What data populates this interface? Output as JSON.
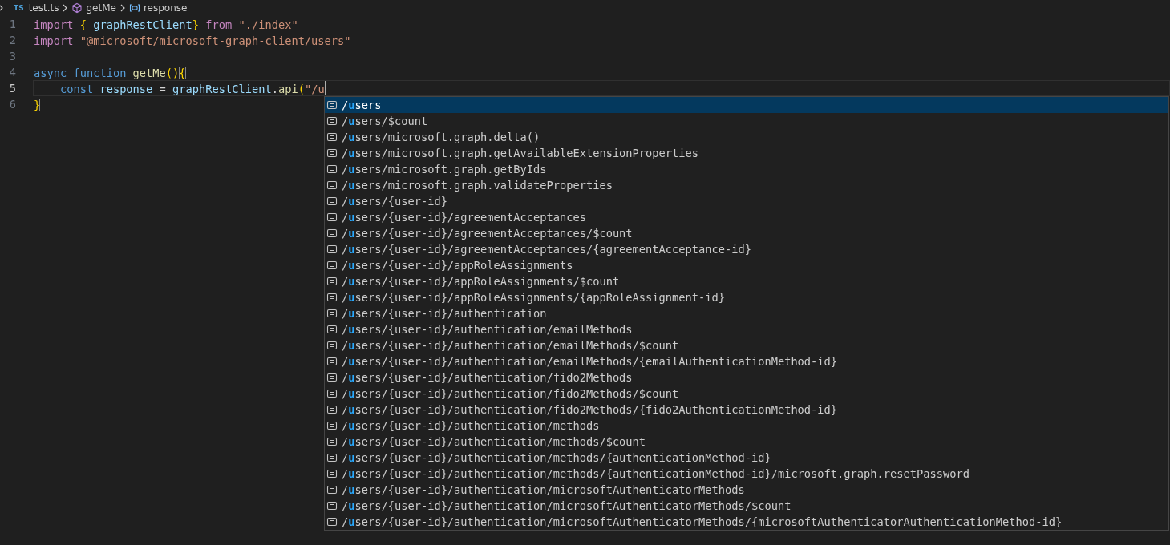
{
  "breadcrumb": {
    "file_badge": "TS",
    "file": "test.ts",
    "function": "getMe",
    "variable": "response"
  },
  "editor": {
    "lines": [
      {
        "number": "1",
        "current": false,
        "tokens": [
          {
            "kind": "control",
            "text": "import"
          },
          {
            "kind": "bracket",
            "text": " {"
          },
          {
            "kind": "variable",
            "text": " graphRestClient"
          },
          {
            "kind": "bracket",
            "text": "}"
          },
          {
            "kind": "control",
            "text": " from"
          },
          {
            "kind": "string",
            "text": " \"./index\""
          }
        ]
      },
      {
        "number": "2",
        "current": false,
        "tokens": [
          {
            "kind": "control",
            "text": "import"
          },
          {
            "kind": "string",
            "text": " \"@microsoft/microsoft-graph-client/users\""
          }
        ]
      },
      {
        "number": "3",
        "current": false
      },
      {
        "number": "4",
        "current": false,
        "tokens": [
          {
            "kind": "keyword",
            "text": "async"
          },
          {
            "kind": "keyword",
            "text": " function"
          },
          {
            "kind": "function",
            "text": " getMe"
          },
          {
            "kind": "bracket",
            "text": "()"
          },
          {
            "kind": "matched",
            "text": "{"
          }
        ]
      },
      {
        "number": "5",
        "current": true,
        "tokens": [
          {
            "kind": "keyword",
            "text": "    const"
          },
          {
            "kind": "variable",
            "text": " response"
          },
          {
            "kind": "plain",
            "text": " = "
          },
          {
            "kind": "variable",
            "text": "graphRestClient"
          },
          {
            "kind": "plain",
            "text": "."
          },
          {
            "kind": "function",
            "text": "api"
          },
          {
            "kind": "bracket",
            "text": "("
          },
          {
            "kind": "string",
            "text": "\"/u"
          }
        ]
      },
      {
        "number": "6",
        "current": false,
        "tokens": [
          {
            "kind": "matched",
            "text": "}"
          }
        ]
      }
    ]
  },
  "suggestions": [
    {
      "lead": "/",
      "match": "u",
      "rest": "sers",
      "selected": true
    },
    {
      "lead": "/",
      "match": "u",
      "rest": "sers/$count",
      "selected": false
    },
    {
      "lead": "/",
      "match": "u",
      "rest": "sers/microsoft.graph.delta()",
      "selected": false
    },
    {
      "lead": "/",
      "match": "u",
      "rest": "sers/microsoft.graph.getAvailableExtensionProperties",
      "selected": false
    },
    {
      "lead": "/",
      "match": "u",
      "rest": "sers/microsoft.graph.getByIds",
      "selected": false
    },
    {
      "lead": "/",
      "match": "u",
      "rest": "sers/microsoft.graph.validateProperties",
      "selected": false
    },
    {
      "lead": "/",
      "match": "u",
      "rest": "sers/{user-id}",
      "selected": false
    },
    {
      "lead": "/",
      "match": "u",
      "rest": "sers/{user-id}/agreementAcceptances",
      "selected": false
    },
    {
      "lead": "/",
      "match": "u",
      "rest": "sers/{user-id}/agreementAcceptances/$count",
      "selected": false
    },
    {
      "lead": "/",
      "match": "u",
      "rest": "sers/{user-id}/agreementAcceptances/{agreementAcceptance-id}",
      "selected": false
    },
    {
      "lead": "/",
      "match": "u",
      "rest": "sers/{user-id}/appRoleAssignments",
      "selected": false
    },
    {
      "lead": "/",
      "match": "u",
      "rest": "sers/{user-id}/appRoleAssignments/$count",
      "selected": false
    },
    {
      "lead": "/",
      "match": "u",
      "rest": "sers/{user-id}/appRoleAssignments/{appRoleAssignment-id}",
      "selected": false
    },
    {
      "lead": "/",
      "match": "u",
      "rest": "sers/{user-id}/authentication",
      "selected": false
    },
    {
      "lead": "/",
      "match": "u",
      "rest": "sers/{user-id}/authentication/emailMethods",
      "selected": false
    },
    {
      "lead": "/",
      "match": "u",
      "rest": "sers/{user-id}/authentication/emailMethods/$count",
      "selected": false
    },
    {
      "lead": "/",
      "match": "u",
      "rest": "sers/{user-id}/authentication/emailMethods/{emailAuthenticationMethod-id}",
      "selected": false
    },
    {
      "lead": "/",
      "match": "u",
      "rest": "sers/{user-id}/authentication/fido2Methods",
      "selected": false
    },
    {
      "lead": "/",
      "match": "u",
      "rest": "sers/{user-id}/authentication/fido2Methods/$count",
      "selected": false
    },
    {
      "lead": "/",
      "match": "u",
      "rest": "sers/{user-id}/authentication/fido2Methods/{fido2AuthenticationMethod-id}",
      "selected": false
    },
    {
      "lead": "/",
      "match": "u",
      "rest": "sers/{user-id}/authentication/methods",
      "selected": false
    },
    {
      "lead": "/",
      "match": "u",
      "rest": "sers/{user-id}/authentication/methods/$count",
      "selected": false
    },
    {
      "lead": "/",
      "match": "u",
      "rest": "sers/{user-id}/authentication/methods/{authenticationMethod-id}",
      "selected": false
    },
    {
      "lead": "/",
      "match": "u",
      "rest": "sers/{user-id}/authentication/methods/{authenticationMethod-id}/microsoft.graph.resetPassword",
      "selected": false
    },
    {
      "lead": "/",
      "match": "u",
      "rest": "sers/{user-id}/authentication/microsoftAuthenticatorMethods",
      "selected": false
    },
    {
      "lead": "/",
      "match": "u",
      "rest": "sers/{user-id}/authentication/microsoftAuthenticatorMethods/$count",
      "selected": false
    },
    {
      "lead": "/",
      "match": "u",
      "rest": "sers/{user-id}/authentication/microsoftAuthenticatorMethods/{microsoftAuthenticatorAuthenticationMethod-id}",
      "selected": false
    }
  ]
}
